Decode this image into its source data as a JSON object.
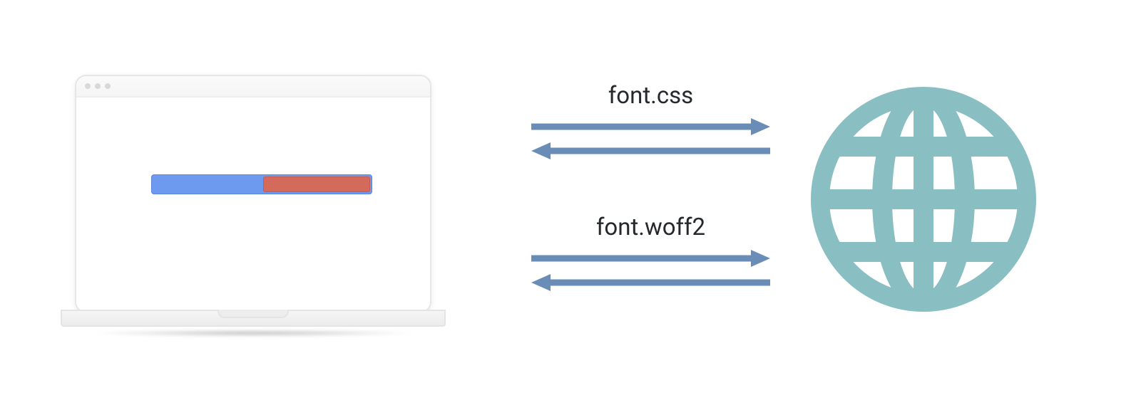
{
  "requests": {
    "css_label": "font.css",
    "font_label": "font.woff2"
  },
  "colors": {
    "arrow": "#6a8db8",
    "globe": "#89bec2",
    "progress_bg": "#6d99ef",
    "progress_fg": "#d36a5c"
  },
  "icons": {
    "laptop": "laptop-icon",
    "globe": "globe-icon",
    "arrow_right": "arrow-right-icon",
    "arrow_left": "arrow-left-icon"
  }
}
